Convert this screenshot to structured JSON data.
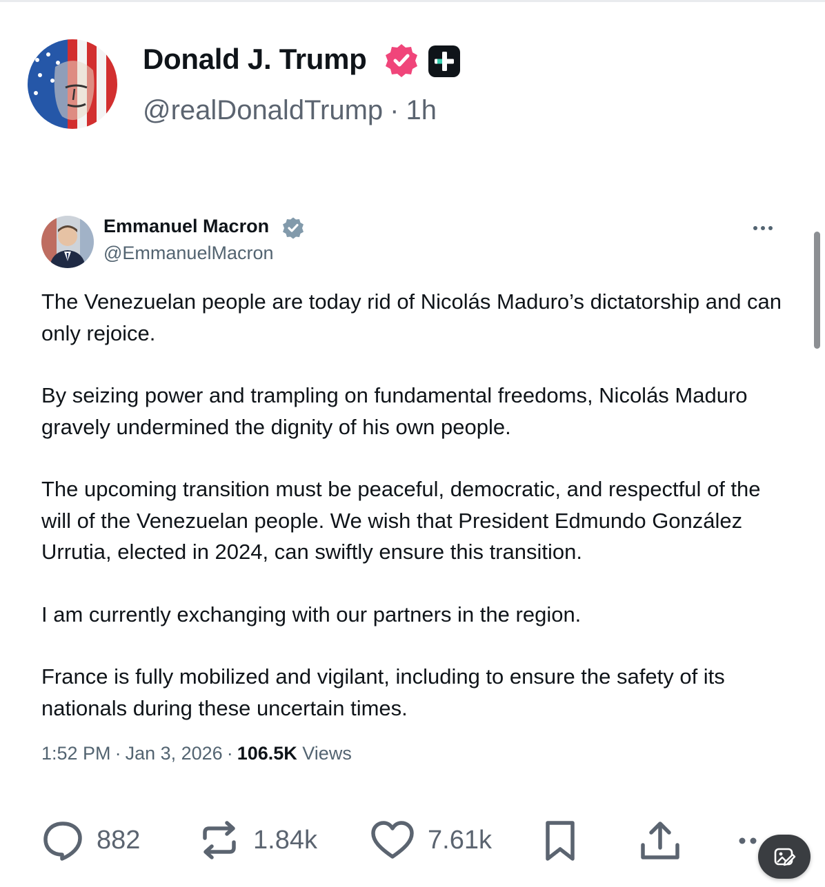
{
  "post": {
    "author_name": "Donald J. Trump",
    "author_handle": "@realDonaldTrump",
    "separator": "·",
    "time": "1h",
    "avatar_icon": "flag-portrait-avatar",
    "badges": [
      "verified-pink-badge-icon",
      "plus-badge-icon"
    ]
  },
  "quoted": {
    "name": "Emmanuel Macron",
    "handle": "@EmmanuelMacron",
    "avatar_icon": "portrait-avatar",
    "verified_icon": "verified-gray-badge-icon",
    "paragraphs": [
      "The Venezuelan people are today rid of Nicolás Maduro’s dictatorship and can only rejoice.",
      "By seizing power and trampling on fundamental freedoms, Nicolás Maduro gravely undermined the dignity of his own people.",
      "The upcoming transition must be peaceful, democratic, and respectful of the will of the Venezuelan people. We wish that President Edmundo González Urrutia, elected in 2024, can swiftly ensure this transition.",
      "I am currently exchanging with our partners in the region.",
      "France is fully mobilized and vigilant, including to ensure the safety of its nationals during these uncertain times."
    ],
    "meta": {
      "time": "1:52 PM",
      "separator": "·",
      "date": "Jan 3, 2026",
      "views_count": "106.5K",
      "views_label": "Views"
    }
  },
  "actions": {
    "replies": "882",
    "reposts": "1.84k",
    "likes": "7.61k"
  },
  "colors": {
    "text_primary": "#0f1419",
    "text_secondary": "#536471",
    "verified_pink": "#e0245e",
    "verified_gray": "#829aab",
    "fab_bg": "#3a3d41"
  }
}
